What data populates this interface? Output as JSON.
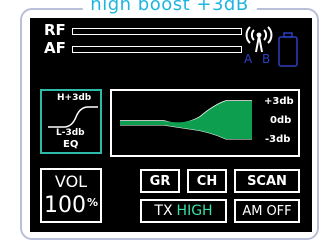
{
  "caption": "high boost +3dB",
  "meters": {
    "rf_label": "RF",
    "af_label": "AF",
    "rf_level": 0.0,
    "af_level": 0.0
  },
  "status": {
    "antenna_icon": "antenna-signal-icon",
    "a_label": "A",
    "b_label": "B",
    "battery_icon": "battery-icon",
    "dim_color": "#2b3fbf"
  },
  "eq_selector": {
    "top_label": "H+3db",
    "bottom_label": "L-3db",
    "eq_label": "EQ"
  },
  "eq_graph": {
    "scale": [
      "+3db",
      "0db",
      "-3db"
    ],
    "fill_color": "#0d9e4f"
  },
  "volume": {
    "label": "VOL",
    "value": "100",
    "unit": "%"
  },
  "buttons": {
    "gr": "GR",
    "ch": "CH",
    "scan": "SCAN",
    "tx": "TX",
    "tx_value": "HIGH",
    "am": "AM",
    "am_value": "OFF"
  },
  "colors": {
    "accent_teal": "#2bbba8",
    "highlight_green": "#37e0a8",
    "caption_blue": "#1fb5df"
  }
}
